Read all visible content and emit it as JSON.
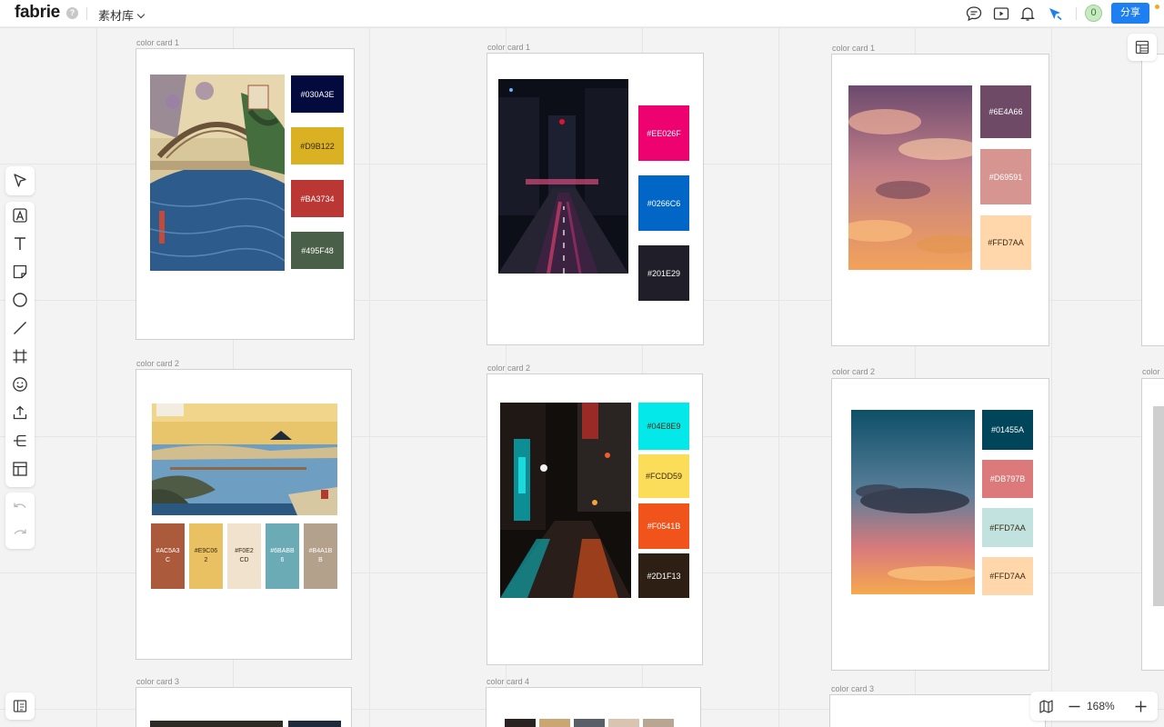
{
  "app": {
    "logo": "fabrie",
    "help": "?",
    "library": "素材库"
  },
  "topbar": {
    "avatar_count": "0",
    "share_label": "分享"
  },
  "zoom": {
    "level": "168%"
  },
  "frames": {
    "a1": {
      "label": "color card 1",
      "swatches": [
        "#030A3E",
        "#D9B122",
        "#BA3734",
        "#495F48"
      ]
    },
    "a2": {
      "label": "color card 2",
      "swatches": [
        "#AC5A3C",
        "#E9C062",
        "#F0E2CD",
        "#6BABB6",
        "#B4A18B"
      ]
    },
    "a3": {
      "label": "color card 3"
    },
    "b1": {
      "label": "color card 1",
      "swatches": [
        "#EE026F",
        "#0266C6",
        "#201E29"
      ]
    },
    "b2": {
      "label": "color card 2",
      "swatches": [
        "#04E8E9",
        "#FCDD59",
        "#F0541B",
        "#2D1F13"
      ]
    },
    "b4": {
      "label": "color card 4"
    },
    "c1": {
      "label": "color card 1",
      "swatches": [
        "#6E4A66",
        "#D69591",
        "#FFD7AA"
      ]
    },
    "c2": {
      "label": "color card 2",
      "swatches": [
        "#01455A",
        "#DB797B",
        "#FFD7AA",
        "#FFD7AA"
      ]
    },
    "c3": {
      "label": "color card 3"
    },
    "d2": {
      "label": "color ca"
    }
  },
  "a2_swatch_display": [
    [
      "#AC5A3",
      "C"
    ],
    [
      "#E9C06",
      "2"
    ],
    [
      "#F0E2",
      "CD"
    ],
    [
      "#6BABB",
      "6"
    ],
    [
      "#B4A1B",
      "B"
    ]
  ],
  "colors": {
    "a1": [
      "#030A3E",
      "#D9B122",
      "#BA3734",
      "#495F48"
    ],
    "a2": [
      "#AC5A3C",
      "#E9C062",
      "#F0E2CD",
      "#6BABB6",
      "#B4A18B"
    ],
    "b1": [
      "#EE026F",
      "#0266C6",
      "#201E29"
    ],
    "b2": [
      "#04E8E9",
      "#FCDD59",
      "#F0541B",
      "#2D1F13"
    ],
    "c1": [
      "#6E4A66",
      "#D69591",
      "#FFD7AA"
    ],
    "c2": [
      "#01455A",
      "#DB797B",
      "#C2E2DF",
      "#FFD7AA"
    ],
    "accent": "#1D7FF0"
  },
  "icons": [
    "help-icon",
    "chevron-down-icon",
    "comment-icon",
    "present-icon",
    "bell-icon",
    "cursor-follow-icon",
    "layout-panel-icon",
    "select-arrow-icon",
    "font-frame-icon",
    "text-icon",
    "sticky-note-icon",
    "circle-icon",
    "line-icon",
    "frame-icon",
    "emoji-icon",
    "upload-icon",
    "mindmap-icon",
    "template-icon",
    "undo-icon",
    "redo-icon",
    "sidebar-icon",
    "map-icon",
    "zoom-out-icon",
    "zoom-in-icon"
  ]
}
